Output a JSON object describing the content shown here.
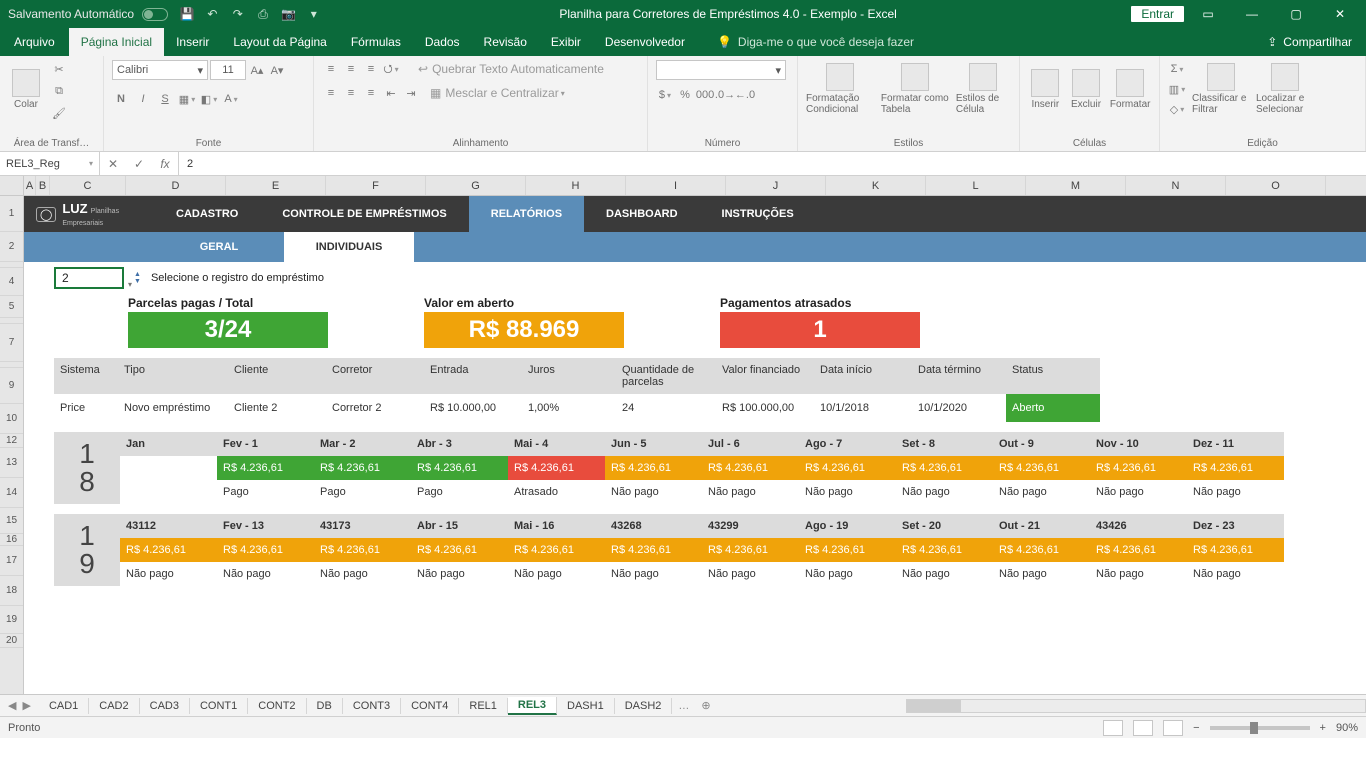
{
  "titlebar": {
    "autosave": "Salvamento Automático",
    "title": "Planilha para Corretores de Empréstimos 4.0 - Exemplo  -  Excel",
    "signin": "Entrar"
  },
  "tabs": {
    "file": "Arquivo",
    "home": "Página Inicial",
    "insert": "Inserir",
    "layout": "Layout da Página",
    "formulas": "Fórmulas",
    "data": "Dados",
    "review": "Revisão",
    "view": "Exibir",
    "developer": "Desenvolvedor",
    "tell": "Diga-me o que você deseja fazer",
    "share": "Compartilhar"
  },
  "ribbon": {
    "clipboard": {
      "paste": "Colar",
      "label": "Área de Transf…"
    },
    "font": {
      "name": "Calibri",
      "size": "11",
      "label": "Fonte"
    },
    "alignment": {
      "wrap": "Quebrar Texto Automaticamente",
      "merge": "Mesclar e Centralizar",
      "label": "Alinhamento"
    },
    "number": {
      "label": "Número"
    },
    "styles": {
      "cond": "Formatação Condicional",
      "table": "Formatar como Tabela",
      "cell": "Estilos de Célula",
      "label": "Estilos"
    },
    "cells": {
      "insert": "Inserir",
      "delete": "Excluir",
      "format": "Formatar",
      "label": "Células"
    },
    "editing": {
      "sort": "Classificar e Filtrar",
      "find": "Localizar e Selecionar",
      "label": "Edição"
    }
  },
  "fbar": {
    "name": "REL3_Reg",
    "value": "2"
  },
  "columns": [
    "A",
    "B",
    "C",
    "D",
    "E",
    "F",
    "G",
    "H",
    "I",
    "J",
    "K",
    "L",
    "M",
    "N",
    "O"
  ],
  "rows_left": [
    "1",
    "2",
    "",
    "4",
    "5",
    "",
    "7",
    "",
    "9",
    "10",
    "12",
    "13",
    "14",
    "15",
    "16",
    "17",
    "18",
    "19",
    "20"
  ],
  "app": {
    "logo": "LUZ",
    "logo_sub": "Planilhas Empresariais",
    "nav": {
      "cad": "CADASTRO",
      "ctrl": "CONTROLE DE EMPRÉSTIMOS",
      "rel": "RELATÓRIOS",
      "dash": "DASHBOARD",
      "inst": "INSTRUÇÕES"
    },
    "subtabs": {
      "geral": "GERAL",
      "indiv": "INDIVIDUAIS"
    },
    "selector": {
      "value": "2",
      "label": "Selecione o registro do empréstimo"
    },
    "kpi": {
      "paid_title": "Parcelas pagas / Total",
      "paid_value": "3/24",
      "open_title": "Valor em aberto",
      "open_value": "R$ 88.969",
      "late_title": "Pagamentos atrasados",
      "late_value": "1"
    },
    "headers": {
      "sistema": "Sistema",
      "tipo": "Tipo",
      "cliente": "Cliente",
      "corretor": "Corretor",
      "entrada": "Entrada",
      "juros": "Juros",
      "qtd": "Quantidade de parcelas",
      "valor": "Valor financiado",
      "inicio": "Data início",
      "termino": "Data término",
      "status": "Status"
    },
    "row": {
      "sistema": "Price",
      "tipo": "Novo empréstimo",
      "cliente": "Cliente 2",
      "corretor": "Corretor 2",
      "entrada": "R$ 10.000,00",
      "juros": "1,00%",
      "qtd": "24",
      "valor": "R$ 100.000,00",
      "inicio": "10/1/2018",
      "termino": "10/1/2020",
      "status": "Aberto"
    },
    "year18": {
      "label_a": "1",
      "label_b": "8",
      "months": [
        "Jan",
        "Fev - 1",
        "Mar - 2",
        "Abr - 3",
        "Mai - 4",
        "Jun - 5",
        "Jul - 6",
        "Ago - 7",
        "Set - 8",
        "Out - 9",
        "Nov - 10",
        "Dez - 11"
      ],
      "amounts": [
        "",
        "R$ 4.236,61",
        "R$ 4.236,61",
        "R$ 4.236,61",
        "R$ 4.236,61",
        "R$ 4.236,61",
        "R$ 4.236,61",
        "R$ 4.236,61",
        "R$ 4.236,61",
        "R$ 4.236,61",
        "R$ 4.236,61",
        "R$ 4.236,61"
      ],
      "colors": [
        "",
        "g",
        "g",
        "g",
        "r",
        "o",
        "o",
        "o",
        "o",
        "o",
        "o",
        "o"
      ],
      "status": [
        "",
        "Pago",
        "Pago",
        "Pago",
        "Atrasado",
        "Não pago",
        "Não pago",
        "Não pago",
        "Não pago",
        "Não pago",
        "Não pago",
        "Não pago"
      ]
    },
    "year19": {
      "label_a": "1",
      "label_b": "9",
      "months": [
        "43112",
        "Fev - 13",
        "43173",
        "Abr - 15",
        "Mai - 16",
        "43268",
        "43299",
        "Ago - 19",
        "Set - 20",
        "Out - 21",
        "43426",
        "Dez - 23"
      ],
      "amounts": [
        "R$ 4.236,61",
        "R$ 4.236,61",
        "R$ 4.236,61",
        "R$ 4.236,61",
        "R$ 4.236,61",
        "R$ 4.236,61",
        "R$ 4.236,61",
        "R$ 4.236,61",
        "R$ 4.236,61",
        "R$ 4.236,61",
        "R$ 4.236,61",
        "R$ 4.236,61"
      ],
      "colors": [
        "o",
        "o",
        "o",
        "o",
        "o",
        "o",
        "o",
        "o",
        "o",
        "o",
        "o",
        "o"
      ],
      "status": [
        "Não pago",
        "Não pago",
        "Não pago",
        "Não pago",
        "Não pago",
        "Não pago",
        "Não pago",
        "Não pago",
        "Não pago",
        "Não pago",
        "Não pago",
        "Não pago"
      ]
    }
  },
  "sheets": [
    "CAD1",
    "CAD2",
    "CAD3",
    "CONT1",
    "CONT2",
    "DB",
    "CONT3",
    "CONT4",
    "REL1",
    "REL3",
    "DASH1",
    "DASH2"
  ],
  "sheets_more": "…",
  "status": {
    "ready": "Pronto",
    "zoom": "90%"
  }
}
